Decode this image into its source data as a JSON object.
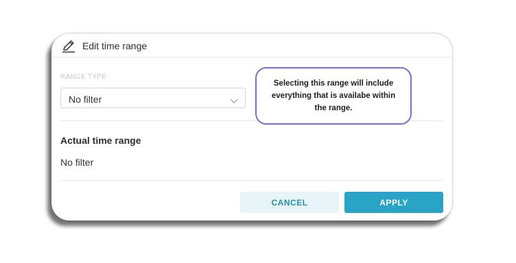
{
  "dialog": {
    "title": "Edit time range",
    "header_icon": "pencil-icon"
  },
  "range_type": {
    "label": "RANGE TYPE",
    "selected": "No filter",
    "dropdown_icon": "chevron-down-icon"
  },
  "actual_range": {
    "title": "Actual time range",
    "value": "No filter"
  },
  "buttons": {
    "cancel_label": "CANCEL",
    "apply_label": "APPLY"
  },
  "tooltip": {
    "text": "Selecting this range will include everything that is availabe within the range."
  },
  "colors": {
    "accent": "#2aa4c6",
    "cancel_bg": "#e6f3f7",
    "tooltip_border": "#7b6fc2"
  }
}
